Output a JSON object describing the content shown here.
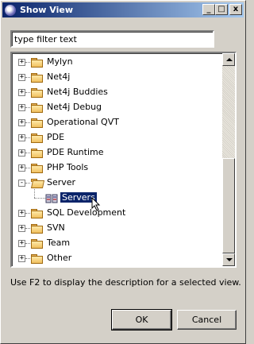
{
  "window": {
    "title": "Show View",
    "controls": {
      "minimize": "_",
      "maximize": "□",
      "close": "x"
    }
  },
  "filter": {
    "value": "",
    "placeholder": "type filter text"
  },
  "tree": {
    "items": [
      {
        "label": "Mylyn",
        "expanded": false,
        "icon": "folder-icon"
      },
      {
        "label": "Net4j",
        "expanded": false,
        "icon": "folder-icon"
      },
      {
        "label": "Net4j Buddies",
        "expanded": false,
        "icon": "folder-icon"
      },
      {
        "label": "Net4j Debug",
        "expanded": false,
        "icon": "folder-icon"
      },
      {
        "label": "Operational QVT",
        "expanded": false,
        "icon": "folder-icon"
      },
      {
        "label": "PDE",
        "expanded": false,
        "icon": "folder-icon"
      },
      {
        "label": "PDE Runtime",
        "expanded": false,
        "icon": "folder-icon"
      },
      {
        "label": "PHP Tools",
        "expanded": false,
        "icon": "folder-icon"
      },
      {
        "label": "Server",
        "expanded": true,
        "icon": "folder-open-icon"
      },
      {
        "label": "Servers",
        "child": true,
        "selected": true,
        "icon": "server-icon"
      },
      {
        "label": "SQL Development",
        "expanded": false,
        "icon": "folder-icon"
      },
      {
        "label": "SVN",
        "expanded": false,
        "icon": "folder-icon"
      },
      {
        "label": "Team",
        "expanded": false,
        "icon": "folder-icon"
      },
      {
        "label": "Other",
        "expanded": false,
        "icon": "folder-icon"
      }
    ]
  },
  "hint": "Use F2 to display the description for a selected view.",
  "buttons": {
    "ok": "OK",
    "cancel": "Cancel"
  },
  "colors": {
    "selection": "#0a246a",
    "title_start": "#0a246a",
    "title_end": "#a6caf0"
  }
}
